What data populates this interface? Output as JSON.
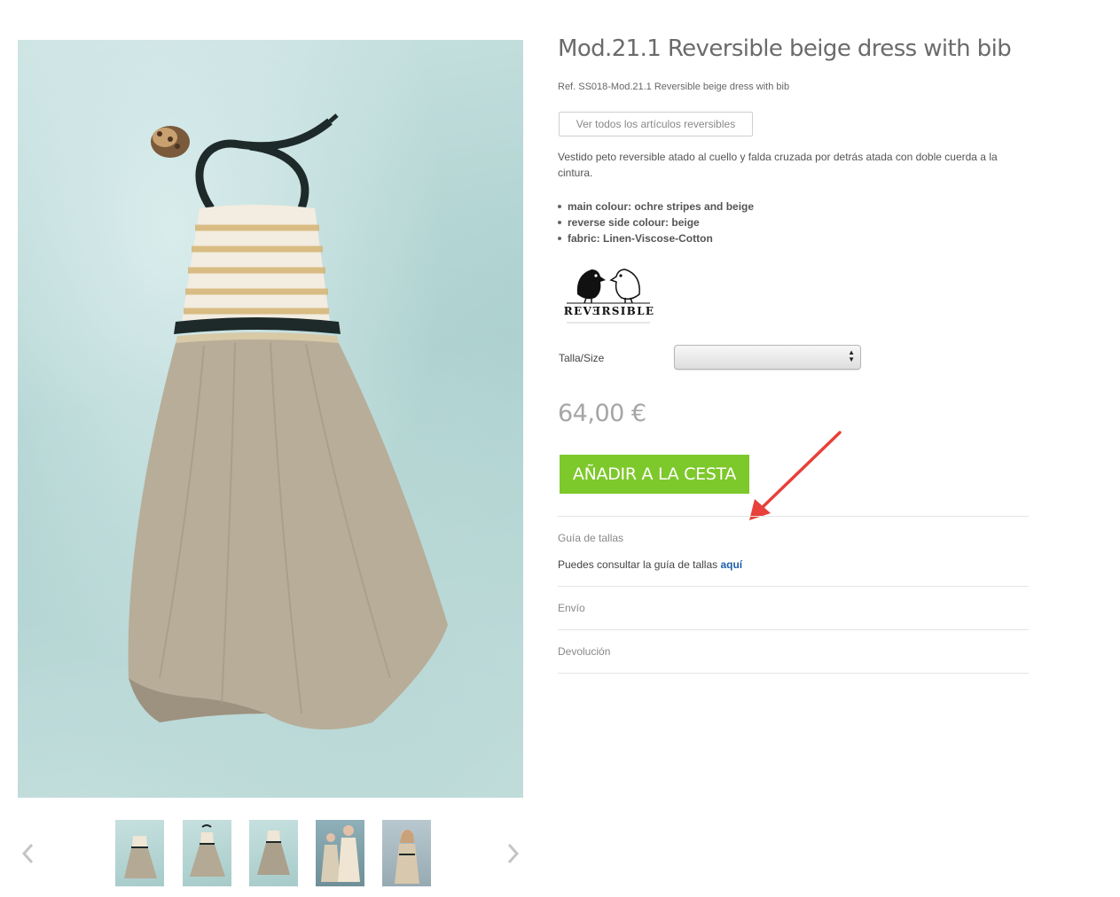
{
  "product": {
    "title": "Mod.21.1 Reversible beige dress with bib",
    "reference": "Ref. SS018-Mod.21.1 Reversible beige dress with bib",
    "reversible_link_label": "Ver todos los artículos reversibles",
    "description": "Vestido peto reversible atado al cuello y falda cruzada por detrás atada con doble cuerda a la cintura.",
    "features": [
      "main colour: ochre stripes and beige",
      "reverse side colour: beige",
      "fabric: Linen-Viscose-Cotton"
    ],
    "logo_text": "REVƎRSIBLE",
    "size_label": "Talla/Size",
    "size_value": "",
    "price": "64,00 €",
    "add_to_cart_label": "AÑADIR A LA CESTA"
  },
  "info_sections": {
    "size_guide_title": "Guía de tallas",
    "size_guide_text": "Puedes consultar la guía de tallas ",
    "size_guide_link": "aquí",
    "shipping_title": "Envío",
    "returns_title": "Devolución"
  },
  "gallery": {
    "prev_icon": "chevron-left-icon",
    "next_icon": "chevron-right-icon",
    "thumbnail_count": 5
  },
  "colors": {
    "accent_green": "#7dc82b",
    "link_blue": "#1f5fa8",
    "annotation_red": "#e8403a",
    "price_grey": "#a6a6a6"
  }
}
